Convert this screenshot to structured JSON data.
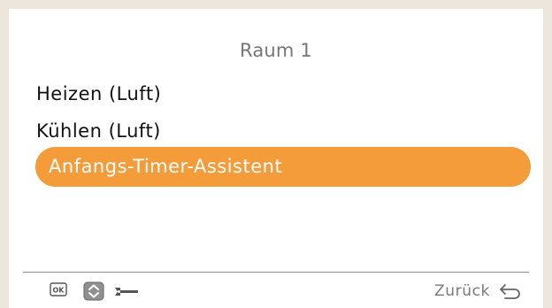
{
  "screen": {
    "title": "Raum 1"
  },
  "menu": {
    "items": [
      {
        "label": "Heizen (Luft)"
      },
      {
        "label": "Kühlen (Luft)"
      },
      {
        "label": "Anfangs-Timer-Assistent",
        "selected": true
      }
    ]
  },
  "footer": {
    "ok_icon_text": "OK",
    "icons": [
      "ok-icon",
      "up-down-icon",
      "wrench-icon",
      "back-arrow-icon"
    ],
    "back_label": "Zurück"
  },
  "colors": {
    "background": "#ede6dd",
    "panel": "#ffffff",
    "selection": "#f49b3a",
    "title_text": "#767676",
    "item_text": "#111111",
    "selected_text": "#ffffff",
    "footer_text": "#7a7a7a"
  }
}
